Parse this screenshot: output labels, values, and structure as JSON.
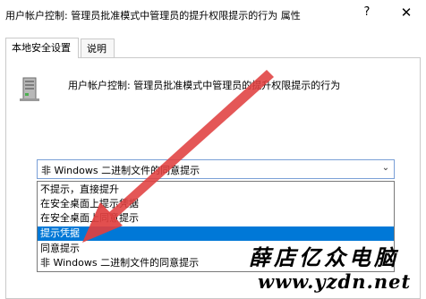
{
  "window": {
    "title": "用户帐户控制: 管理员批准模式中管理员的提升权限提示的行为 属性",
    "help_glyph": "?",
    "close_glyph": "✕"
  },
  "tabs": [
    {
      "label": "本地安全设置",
      "active": true
    },
    {
      "label": "说明",
      "active": false
    }
  ],
  "policy": {
    "icon": "server-computer-icon",
    "title": "用户帐户控制: 管理员批准模式中管理员的提升权限提示的行为"
  },
  "setting_select": {
    "value": "非 Windows 二进制文件的同意提示",
    "arrow_glyph": "⌄",
    "options": [
      "不提示，直接提升",
      "在安全桌面上提示凭据",
      "在安全桌面上同意提示",
      "提示凭据",
      "同意提示",
      "非 Windows 二进制文件的同意提示"
    ],
    "highlighted_option": "提示凭据"
  },
  "annotation": {
    "arrow_color": "#e04040"
  },
  "watermark": {
    "brand": "薛店亿众电脑",
    "url": "www.yzdn.net"
  },
  "colors": {
    "selection": "#0078d7",
    "border": "#c9c9c9",
    "combo_border": "#7a9fd6"
  }
}
